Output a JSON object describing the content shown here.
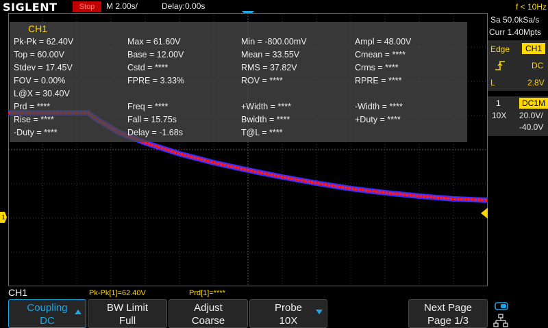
{
  "top": {
    "logo": "SIGLENT",
    "run_status": "Stop",
    "timebase": "M 2.00s/",
    "delay": "Delay:0.00s",
    "freq_counter": "f < 10Hz"
  },
  "measurements": {
    "title": "CH1",
    "rows": [
      [
        "Pk-Pk = 62.40V",
        "Max = 61.60V",
        "Min = -800.00mV",
        "Ampl = 48.00V"
      ],
      [
        "Top = 60.00V",
        "Base = 12.00V",
        "Mean = 33.55V",
        "Cmean = ****"
      ],
      [
        "Stdev = 17.45V",
        "Cstd = ****",
        "RMS = 37.82V",
        "Crms = ****"
      ],
      [
        "FOV = 0.00%",
        "FPRE = 3.33%",
        "ROV = ****",
        "RPRE = ****"
      ],
      [
        "L@X = 30.40V",
        "",
        "",
        ""
      ],
      [
        "Prd = ****",
        "Freq = ****",
        "+Width = ****",
        "-Width = ****"
      ],
      [
        "Rise = ****",
        "Fall = 15.75s",
        "Bwidth = ****",
        "+Duty = ****"
      ],
      [
        "-Duty = ****",
        "Delay = -1.68s",
        "T@L = ****",
        ""
      ]
    ]
  },
  "right_panel": {
    "sample_rate": "Sa 50.0kSa/s",
    "curr_points": "Curr 1.40Mpts",
    "trigger_label": "Edge",
    "trigger_source": "CH1",
    "trigger_slope_label": "DC",
    "level_label": "L",
    "level_value": "2.8V",
    "channel_num": "1",
    "coupling_badge": "DC1M",
    "probe": "10X",
    "volts_div": "20.0V/",
    "offset": "-40.0V"
  },
  "channel_marker": "1",
  "status": {
    "channel": "CH1",
    "pkpk": "Pk-Pk[1]=62.40V",
    "prd": "Prd[1]=****"
  },
  "softkeys": [
    {
      "line1": "Coupling",
      "line2": "DC"
    },
    {
      "line1": "BW Limit",
      "line2": "Full"
    },
    {
      "line1": "Adjust",
      "line2": "Coarse"
    },
    {
      "line1": "Probe",
      "line2": "10X"
    },
    {
      "line1": "Next Page",
      "line2": "Page 1/3"
    }
  ],
  "colors": {
    "ch1": "#ffd800",
    "accent": "#1ea7e6",
    "trace_red": "#ff1a1a",
    "trace_blue": "#3a2dff"
  }
}
